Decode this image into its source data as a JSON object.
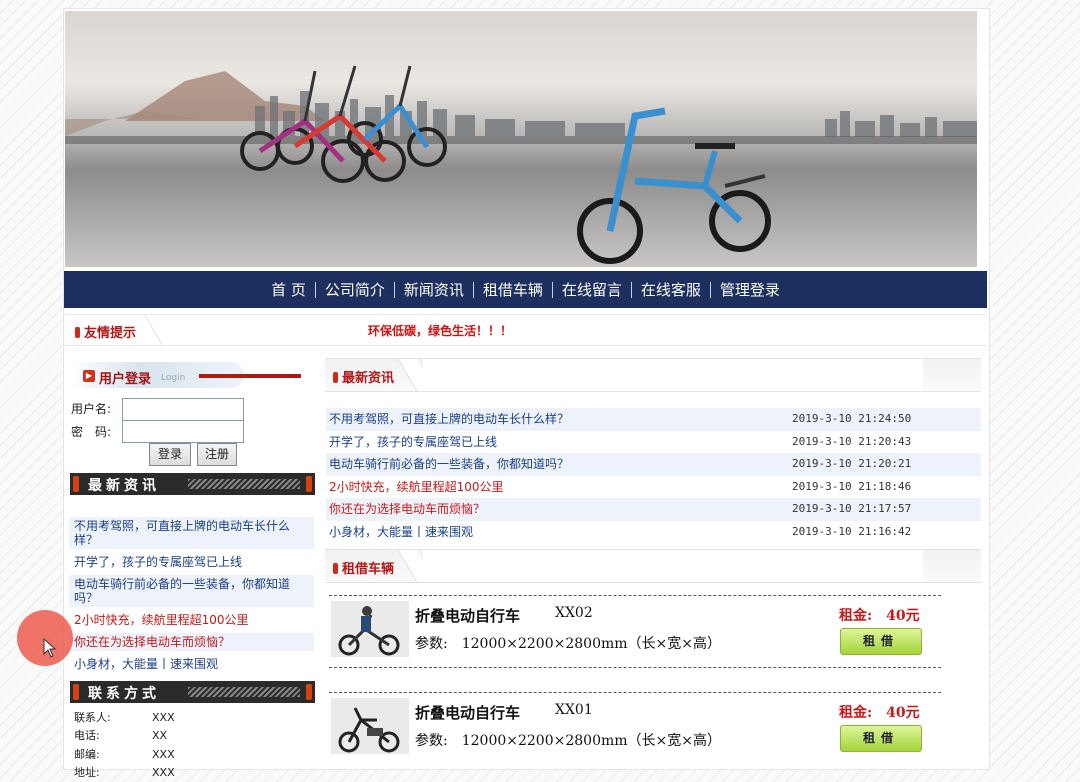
{
  "nav": {
    "items": [
      "首 页",
      "公司简介",
      "新闻资讯",
      "租借车辆",
      "在线留言",
      "在线客服",
      "管理登录"
    ]
  },
  "tip": {
    "label": "友情提示",
    "text": "环保低碳，绿色生活！！！"
  },
  "login": {
    "title": "用户登录",
    "subtitle": "Login",
    "username_label": "用户名:",
    "password_label": "密　码:",
    "login_button": "登录",
    "register_button": "注册"
  },
  "left_news": {
    "title": "最新资讯",
    "items": [
      "不用考驾照，可直接上牌的电动车长什么样？",
      "开学了，孩子的专属座驾已上线",
      "电动车骑行前必备的一些装备，你都知道吗？",
      "2小时快充，续航里程超100公里",
      "你还在为选择电动车而烦恼？",
      "小身材，大能量丨速来围观"
    ]
  },
  "contact": {
    "title": "联系方式",
    "rows": [
      {
        "k": "联系人:",
        "v": "XXX"
      },
      {
        "k": "电话:",
        "v": "XX"
      },
      {
        "k": "邮编:",
        "v": "XXX"
      },
      {
        "k": "地址:",
        "v": "XXX"
      }
    ]
  },
  "main_news": {
    "title": "最新资讯",
    "items": [
      {
        "title": "不用考驾照，可直接上牌的电动车长什么样？",
        "date": "2019-3-10 21:24:50"
      },
      {
        "title": "开学了，孩子的专属座驾已上线",
        "date": "2019-3-10 21:20:43"
      },
      {
        "title": "电动车骑行前必备的一些装备，你都知道吗？",
        "date": "2019-3-10 21:20:21"
      },
      {
        "title": "2小时快充，续航里程超100公里",
        "date": "2019-3-10 21:18:46"
      },
      {
        "title": "你还在为选择电动车而烦恼？",
        "date": "2019-3-10 21:17:57"
      },
      {
        "title": "小身材，大能量丨速来围观",
        "date": "2019-3-10 21:16:42"
      }
    ]
  },
  "rental": {
    "title": "租借车辆",
    "items": [
      {
        "name": "折叠电动自行车",
        "code": "XX02",
        "params": "参数:　12000×2200×2800mm（长×宽×高）",
        "price": "租金:　40元",
        "button": "租借"
      },
      {
        "name": "折叠电动自行车",
        "code": "XX01",
        "params": "参数:　12000×2200×2800mm（长×宽×高）",
        "price": "租金:　40元",
        "button": "租借"
      }
    ]
  }
}
